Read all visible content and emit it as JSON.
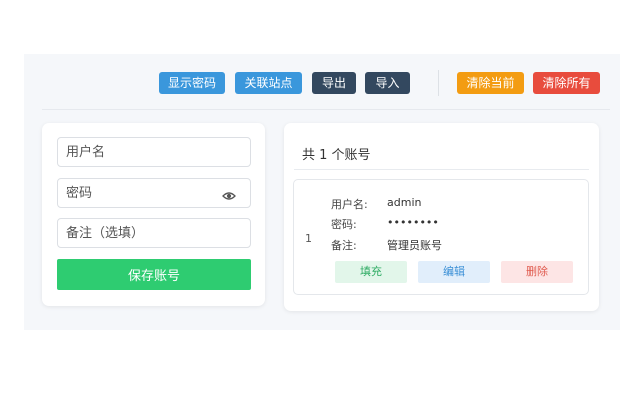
{
  "toolbar": {
    "show_password": "显示密码",
    "link_site": "关联站点",
    "export": "导出",
    "import": "导入",
    "clear_current": "清除当前",
    "clear_all": "清除所有"
  },
  "form": {
    "username_placeholder": "用户名",
    "password_placeholder": "密码",
    "note_placeholder": "备注（选填）",
    "save_label": "保存账号"
  },
  "list": {
    "count_text": "共 1 个账号",
    "items": [
      {
        "index": "1",
        "username_label": "用户名:",
        "username": "admin",
        "password_label": "密码:",
        "password": "••••••••",
        "note_label": "备注:",
        "note": "管理员账号",
        "fill_label": "填充",
        "edit_label": "编辑",
        "delete_label": "删除"
      }
    ]
  },
  "colors": {
    "blue": "#3a97dc",
    "dark": "#33485f",
    "orange": "#f39c12",
    "red": "#e84c3d",
    "green": "#2ecc71"
  },
  "icons": {
    "password_toggle": "eye-icon"
  }
}
